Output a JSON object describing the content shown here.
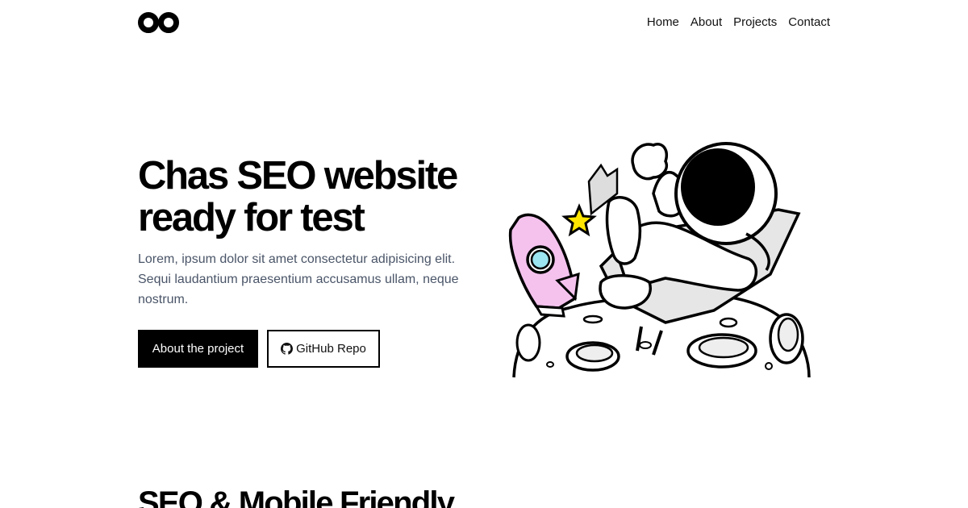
{
  "header": {
    "logo_icon": "infinity-logo",
    "nav": [
      {
        "label": "Home"
      },
      {
        "label": "About"
      },
      {
        "label": "Projects"
      },
      {
        "label": "Contact"
      }
    ]
  },
  "hero": {
    "title": "Chas SEO website\nready for test",
    "description": "Lorem, ipsum dolor sit amet consectetur adipisicing elit. Sequi laudantium praesentium accusamus ullam, neque nostrum.",
    "primary_button": "About the project",
    "secondary_button": "GitHub Repo",
    "secondary_button_icon": "github-icon",
    "illustration": "astronaut-on-moon-illustration"
  },
  "next_section": {
    "title": "SEO & Mobile Friendly"
  },
  "colors": {
    "background": "#ffffff",
    "text": "#000000",
    "muted_text": "#4a5568",
    "rocket": "#f5c2ee",
    "star": "#ffe600",
    "rocket_window": "#9be6f0"
  }
}
